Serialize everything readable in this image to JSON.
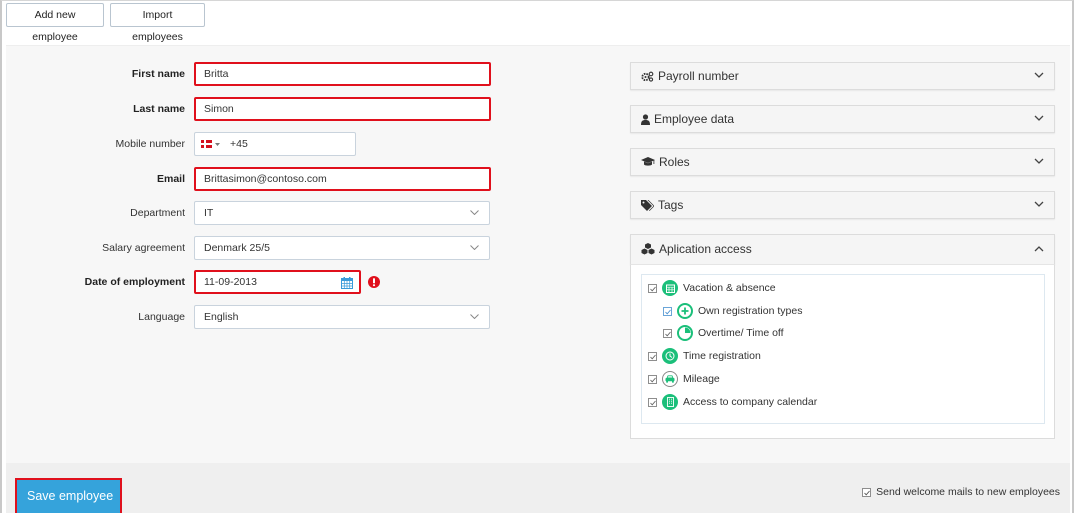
{
  "toolbar": {
    "add_new_employee": "Add new employee",
    "import_employees": "Import employees"
  },
  "form": {
    "first_name": {
      "label": "First name",
      "value": "Britta"
    },
    "last_name": {
      "label": "Last name",
      "value": "Simon"
    },
    "mobile_number": {
      "label": "Mobile number",
      "country": "DK",
      "prefix": "+45"
    },
    "email": {
      "label": "Email",
      "value": "Brittasimon@contoso.com"
    },
    "department": {
      "label": "Department",
      "selected": "IT"
    },
    "salary_agreement": {
      "label": "Salary agreement",
      "selected": "Denmark 25/5"
    },
    "date_of_employment": {
      "label": "Date of employment",
      "value": "11-09-2013"
    },
    "language": {
      "label": "Language",
      "selected": "English"
    }
  },
  "accordions": [
    {
      "label": "Payroll number",
      "icon": "cogs-icon",
      "expanded": false
    },
    {
      "label": "Employee data",
      "icon": "user-icon",
      "expanded": false
    },
    {
      "label": "Roles",
      "icon": "graduation-cap-icon",
      "expanded": false
    },
    {
      "label": "Tags",
      "icon": "tags-icon",
      "expanded": false
    },
    {
      "label": "Aplication access",
      "icon": "cubes-icon",
      "expanded": true
    }
  ],
  "application_access": [
    {
      "label": "Vacation & absence",
      "icon": "calendar-icon",
      "checked": true,
      "level": 0
    },
    {
      "label": "Own registration types",
      "icon": "plus-circle-icon",
      "checked": true,
      "level": 1
    },
    {
      "label": "Overtime/ Time off",
      "icon": "pie-clock-icon",
      "checked": true,
      "level": 1
    },
    {
      "label": "Time registration",
      "icon": "clock-icon",
      "checked": true,
      "level": 0
    },
    {
      "label": "Mileage",
      "icon": "car-icon",
      "checked": true,
      "level": 0
    },
    {
      "label": "Access to company calendar",
      "icon": "building-icon",
      "checked": true,
      "level": 0
    }
  ],
  "footer": {
    "save_button": "Save employee",
    "welcome_mail_label": "Send welcome mails to new employees",
    "welcome_mail_checked": true
  },
  "colors": {
    "accent_blue": "#35a3db",
    "error_red": "#e0101c",
    "app_green": "#1bbf7a"
  }
}
